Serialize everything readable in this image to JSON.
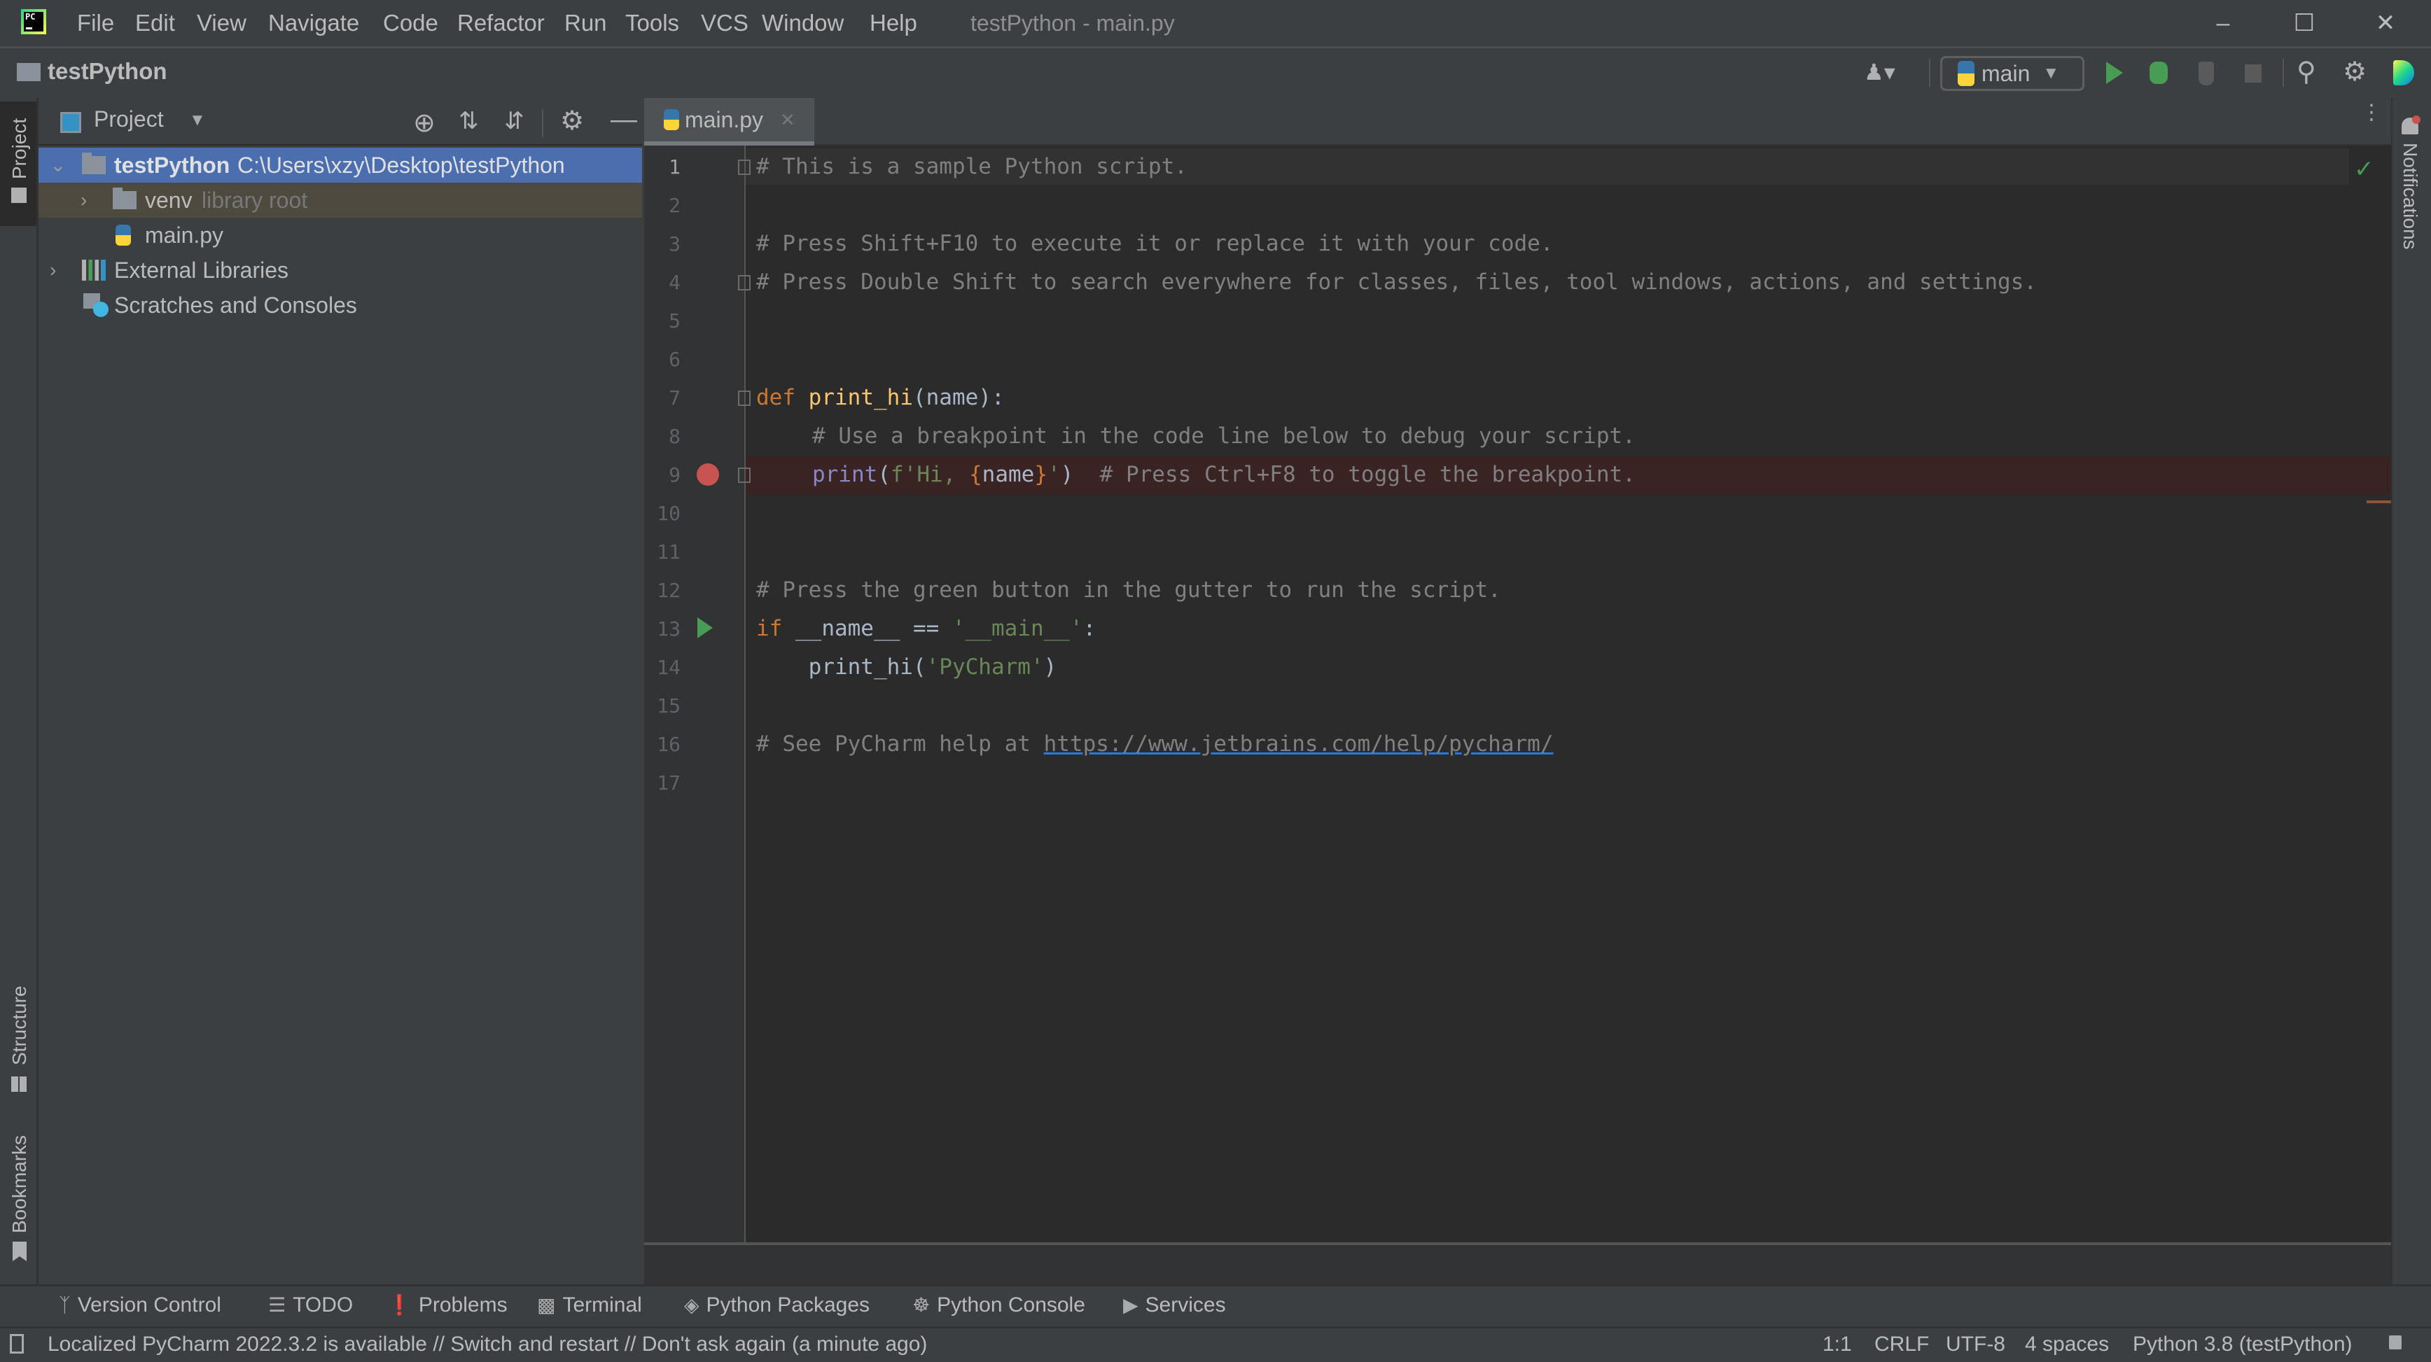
{
  "window": {
    "title": "testPython - main.py",
    "menu": [
      "File",
      "Edit",
      "View",
      "Navigate",
      "Code",
      "Refactor",
      "Run",
      "Tools",
      "VCS",
      "Window",
      "Help"
    ],
    "controls": {
      "minimize": "–",
      "maximize": "☐",
      "close": "✕"
    }
  },
  "navbar": {
    "project": "testPython",
    "run_config": "main",
    "icons": [
      "user-icon",
      "python-icon",
      "run-icon",
      "debug-icon",
      "coverage-icon",
      "stop-icon",
      "search-icon",
      "gear-icon",
      "jetbrains-toolbox-icon"
    ]
  },
  "left_stripe": {
    "project": "Project",
    "structure": "Structure",
    "bookmarks": "Bookmarks"
  },
  "right_stripe": {
    "notifications": "Notifications"
  },
  "project_panel": {
    "title": "Project",
    "tree": [
      {
        "name": "testPython",
        "extra": "C:\\Users\\xzy\\Desktop\\testPython",
        "expanded": true,
        "selected": true
      },
      {
        "name": "venv",
        "extra": "library root",
        "expanded": false
      },
      {
        "name": "main.py",
        "extra": ""
      },
      {
        "name": "External Libraries",
        "extra": "",
        "expanded": false
      },
      {
        "name": "Scratches and Consoles",
        "extra": ""
      }
    ]
  },
  "editor": {
    "tab": "main.py",
    "tab_close": "✕",
    "inspection_status": "ok",
    "line_numbers": [
      "1",
      "2",
      "3",
      "4",
      "5",
      "6",
      "7",
      "8",
      "9",
      "10",
      "11",
      "12",
      "13",
      "14",
      "15",
      "16",
      "17"
    ],
    "lines": {
      "l1": "# This is a sample Python script.",
      "l3": "# Press Shift+F10 to execute it or replace it with your code.",
      "l4": "# Press Double Shift to search everywhere for classes, files, tool windows, actions, and settings.",
      "l7_kw": "def",
      "l7_fn": "print_hi",
      "l7_rest": "(name):",
      "l8": "# Use a breakpoint in the code line below to debug your script.",
      "l9_bi": "print",
      "l9_p1": "(",
      "l9_str1": "f'Hi, ",
      "l9_lb": "{",
      "l9_var": "name",
      "l9_rb": "}",
      "l9_str2": "'",
      "l9_p2": ")",
      "l9_cmt": "  # Press Ctrl+F8 to toggle the breakpoint.",
      "l12": "# Press the green button in the gutter to run the script.",
      "l13_kw": "if",
      "l13_mid": " __name__ == ",
      "l13_str": "'__main__'",
      "l13_end": ":",
      "l14_pre": "    print_hi(",
      "l14_str": "'PyCharm'",
      "l14_end": ")",
      "l16_cmt": "# See PyCharm help at ",
      "l16_link": "https://www.jetbrains.com/help/pycharm/"
    }
  },
  "bottom_tools": [
    "Version Control",
    "TODO",
    "Problems",
    "Terminal",
    "Python Packages",
    "Python Console",
    "Services"
  ],
  "status": {
    "message": "Localized PyCharm 2022.3.2 is available // Switch and restart // Don't ask again (a minute ago)",
    "position": "1:1",
    "line_sep": "CRLF",
    "encoding": "UTF-8",
    "indent": "4 spaces",
    "interpreter": "Python 3.8 (testPython)"
  },
  "colors": {
    "breakpoint": "#c75450",
    "run": "#499c54",
    "selection": "#4b6eaf",
    "library_row": "#4e4a3f"
  }
}
